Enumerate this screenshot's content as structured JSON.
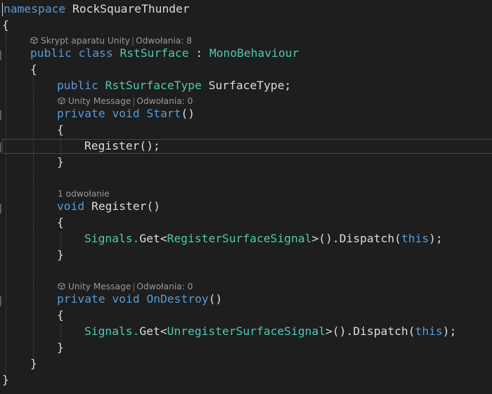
{
  "editor": {
    "lines": {
      "namespace_kw": "namespace",
      "namespace_name": "RockSquareThunder",
      "open_ns": "{",
      "class_public": "public",
      "class_kw": "class",
      "class_name": "RstSurface",
      "class_colon": ":",
      "class_base": "MonoBehaviour",
      "open_class": "{",
      "field_public": "public",
      "field_type": "RstSurfaceType",
      "field_name": "SurfaceType;",
      "start_private": "private",
      "start_void": "void",
      "start_name": "Start",
      "start_parens": "()",
      "start_open": "{",
      "start_body": "Register();",
      "start_close": "}",
      "register_void": "void",
      "register_name": "Register",
      "register_parens": "()",
      "register_open": "{",
      "register_body_1": "Signals.",
      "register_body_2": "Get<",
      "register_body_3": "RegisterSurfaceSignal",
      "register_body_4": ">().",
      "register_body_5": "Dispatch(",
      "register_body_6": "this",
      "register_body_7": ");",
      "register_close": "}",
      "destroy_private": "private",
      "destroy_void": "void",
      "destroy_name": "OnDestroy",
      "destroy_parens": "()",
      "destroy_open": "{",
      "destroy_body_1": "Signals.",
      "destroy_body_2": "Get<",
      "destroy_body_3": "UnregisterSurfaceSignal",
      "destroy_body_4": ">().",
      "destroy_body_5": "Dispatch(",
      "destroy_body_6": "this",
      "destroy_body_7": ");",
      "destroy_close": "}",
      "close_class": "}",
      "close_ns": "}"
    },
    "codelens": {
      "class_script": "Skrypt aparatu Unity",
      "class_refs": "Odwołania: 8",
      "start_msg": "Unity Message",
      "start_refs": "Odwołania: 0",
      "register_refs": "1 odwołanie",
      "destroy_msg": "Unity Message",
      "destroy_refs": "Odwołania: 0",
      "separator": "|"
    },
    "colors": {
      "background": "#1e1e1e",
      "keyword": "#569cd6",
      "type": "#4ec9b0",
      "plain": "#dcdcdc",
      "codelens": "#999999"
    },
    "icons": {
      "codelens_icon": "unity-cube-icon"
    }
  }
}
